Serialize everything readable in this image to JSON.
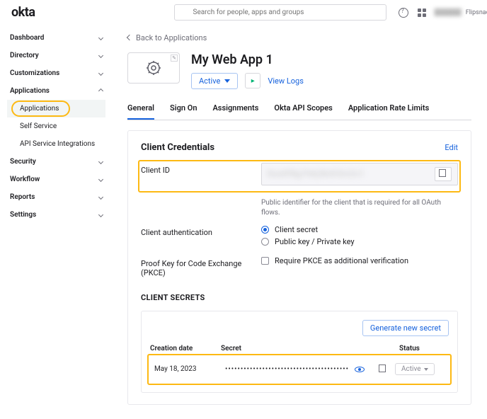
{
  "header": {
    "logo": "okta",
    "search_placeholder": "Search for people, apps and groups",
    "org_name": "Flipsnack"
  },
  "sidebar": {
    "items": [
      {
        "label": "Dashboard",
        "expanded": false
      },
      {
        "label": "Directory",
        "expanded": false
      },
      {
        "label": "Customizations",
        "expanded": false
      },
      {
        "label": "Applications",
        "expanded": true,
        "children": [
          {
            "label": "Applications",
            "active": true
          },
          {
            "label": "Self Service"
          },
          {
            "label": "API Service Integrations"
          }
        ]
      },
      {
        "label": "Security",
        "expanded": false
      },
      {
        "label": "Workflow",
        "expanded": false
      },
      {
        "label": "Reports",
        "expanded": false
      },
      {
        "label": "Settings",
        "expanded": false
      }
    ]
  },
  "main": {
    "back": "Back to Applications",
    "app_title": "My Web App 1",
    "active_label": "Active",
    "view_logs": "View Logs",
    "tabs": [
      "General",
      "Sign On",
      "Assignments",
      "Okta API Scopes",
      "Application Rate Limits"
    ],
    "credentials": {
      "title": "Client Credentials",
      "edit": "Edit",
      "client_id_label": "Client ID",
      "client_id_value": "0oa9f8g7h6j5k4l3m2n1",
      "client_id_help": "Public identifier for the client that is required for all OAuth flows.",
      "auth_label": "Client authentication",
      "auth_opt1": "Client secret",
      "auth_opt2": "Public key / Private key",
      "pkce_label": "Proof Key for Code Exchange (PKCE)",
      "pkce_check": "Require PKCE as additional verification"
    },
    "secrets": {
      "title": "CLIENT SECRETS",
      "generate": "Generate new secret",
      "col_date": "Creation date",
      "col_secret": "Secret",
      "col_status": "Status",
      "row_date": "May 18, 2023",
      "row_secret": "••••••••••••••••••••••••••••••••••••••••",
      "row_status": "Active"
    }
  }
}
